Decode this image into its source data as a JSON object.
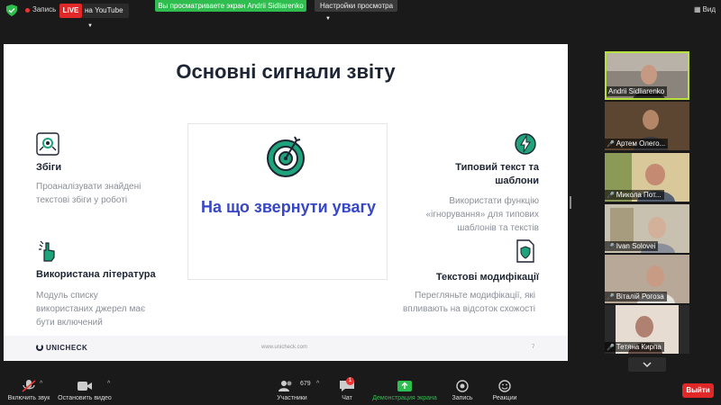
{
  "topbar": {
    "record_label": "Запись",
    "live_label": "LIVE",
    "youtube_label": "на YouTube",
    "banner": "Вы просматриваете экран Andrii Sidliarenko",
    "view_settings": "Настройки просмотра",
    "view_label": "Вид"
  },
  "slide": {
    "title": "Основні сигнали звіту",
    "center_text": "На що звернути увагу",
    "blocks": [
      {
        "title": "Збіги",
        "desc": "Проаналізувати знайдені текстові збіги у роботі"
      },
      {
        "title": "Використана  література",
        "desc": "Модуль списку використаних джерел має бути включений"
      },
      {
        "title": "Типовий текст та шаблони",
        "desc": "Використати функцію «ігнорування» для  типових шаблонів та текстів"
      },
      {
        "title": "Текстові модифікації",
        "desc": "Перегляньте модифікації, які впливають на відсоток схожості"
      }
    ],
    "logo": "UNICHECK",
    "url": "www.unicheck.com",
    "page": "7"
  },
  "participants": [
    {
      "name": "Andrii Sidliarenko",
      "muted": false
    },
    {
      "name": "Артем Олего...",
      "muted": true
    },
    {
      "name": "Микола Пот...",
      "muted": true
    },
    {
      "name": "Ivan Solovei",
      "muted": true
    },
    {
      "name": "Віталій Рогоза",
      "muted": true
    },
    {
      "name": "Тетяна Кирпа",
      "muted": true
    }
  ],
  "toolbar": {
    "mute": "Включить звук",
    "video": "Остановить видео",
    "participants": "Участники",
    "participants_count": "679",
    "chat": "Чат",
    "chat_badge": "1",
    "share": "Демонстрация экрана",
    "record": "Запись",
    "reactions": "Реакции",
    "leave": "Выйти"
  },
  "colors": {
    "accent_green": "#2ebd4e",
    "live_red": "#e02828",
    "slide_blue": "#3847c6",
    "icon_teal": "#1fa37a"
  }
}
